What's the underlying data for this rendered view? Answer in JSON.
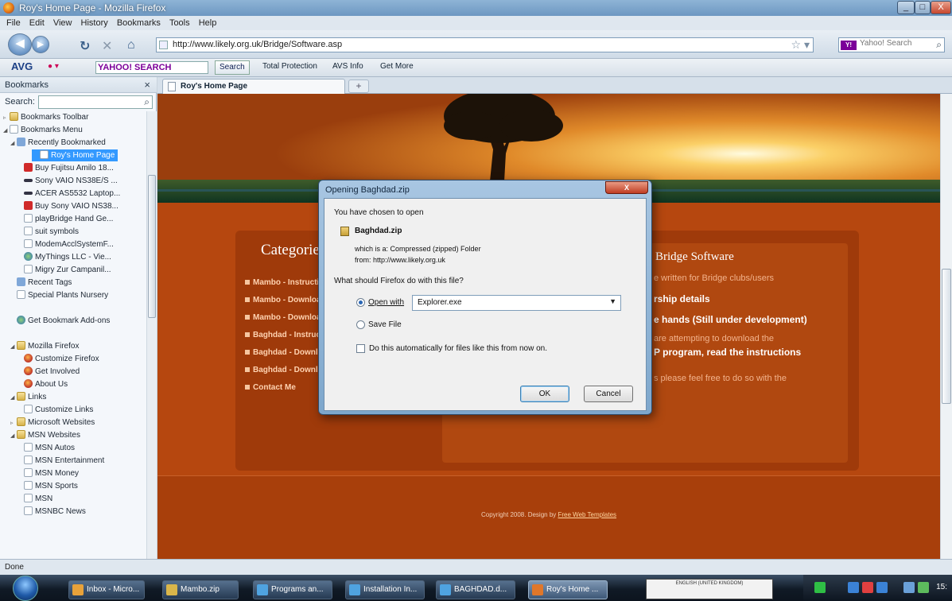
{
  "window": {
    "title": "Roy's Home Page - Mozilla Firefox",
    "controls": [
      "_",
      "□",
      "X"
    ]
  },
  "menu": [
    "File",
    "Edit",
    "View",
    "History",
    "Bookmarks",
    "Tools",
    "Help"
  ],
  "nav": {
    "url": "http://www.likely.org.uk/Bridge/Software.asp",
    "search_placeholder": "Yahoo! Search",
    "search_engine_label": "Y!"
  },
  "avg_toolbar": {
    "logo": "AVG",
    "search_brand": "YAHOO! SEARCH",
    "search_button": "Search",
    "total_protection": "Total Protection",
    "avs_info": "AVS Info",
    "get_more": "Get More"
  },
  "sidebar": {
    "title": "Bookmarks",
    "search_label": "Search:",
    "items": [
      {
        "label": "Bookmarks Toolbar",
        "icon": "folder",
        "indent": 0,
        "tw": "▹"
      },
      {
        "label": "Bookmarks Menu",
        "icon": "page",
        "indent": 0,
        "tw": "◢"
      },
      {
        "label": "Recently Bookmarked",
        "icon": "bookmarkstar",
        "indent": 1,
        "tw": "◢"
      },
      {
        "label": "Roy's Home Page",
        "icon": "page",
        "indent": 2,
        "tw": "",
        "selected": true
      },
      {
        "label": "Buy Fujitsu Amilo 18...",
        "icon": "red",
        "indent": 2,
        "tw": ""
      },
      {
        "label": "Sony VAIO NS38E/S ...",
        "icon": "bar",
        "indent": 2,
        "tw": ""
      },
      {
        "label": "ACER AS5532 Laptop...",
        "icon": "bar",
        "indent": 2,
        "tw": ""
      },
      {
        "label": "Buy Sony VAIO NS38...",
        "icon": "red",
        "indent": 2,
        "tw": ""
      },
      {
        "label": "playBridge Hand Ge...",
        "icon": "page",
        "indent": 2,
        "tw": ""
      },
      {
        "label": "suit symbols",
        "icon": "page",
        "indent": 2,
        "tw": ""
      },
      {
        "label": "ModemAcclSystemF...",
        "icon": "page",
        "indent": 2,
        "tw": ""
      },
      {
        "label": "MyThings LLC - Vie...",
        "icon": "globe",
        "indent": 2,
        "tw": ""
      },
      {
        "label": "Migry Zur Campanil...",
        "icon": "page",
        "indent": 2,
        "tw": ""
      },
      {
        "label": "Recent Tags",
        "icon": "bookmarkstar",
        "indent": 1,
        "tw": ""
      },
      {
        "label": "Special Plants Nursery",
        "icon": "page",
        "indent": 1,
        "tw": ""
      },
      {
        "label": "",
        "icon": "",
        "indent": 0,
        "tw": ""
      },
      {
        "label": "Get Bookmark Add-ons",
        "icon": "globe",
        "indent": 1,
        "tw": ""
      },
      {
        "label": "",
        "icon": "",
        "indent": 0,
        "tw": ""
      },
      {
        "label": "Mozilla Firefox",
        "icon": "folder",
        "indent": 1,
        "tw": "◢"
      },
      {
        "label": "Customize Firefox",
        "icon": "ff",
        "indent": 2,
        "tw": ""
      },
      {
        "label": "Get Involved",
        "icon": "ff",
        "indent": 2,
        "tw": ""
      },
      {
        "label": "About Us",
        "icon": "ff",
        "indent": 2,
        "tw": ""
      },
      {
        "label": "Links",
        "icon": "folder",
        "indent": 1,
        "tw": "◢"
      },
      {
        "label": "Customize Links",
        "icon": "page",
        "indent": 2,
        "tw": ""
      },
      {
        "label": "Microsoft Websites",
        "icon": "folder",
        "indent": 1,
        "tw": "▹"
      },
      {
        "label": "MSN Websites",
        "icon": "folder",
        "indent": 1,
        "tw": "◢"
      },
      {
        "label": "MSN Autos",
        "icon": "page",
        "indent": 2,
        "tw": ""
      },
      {
        "label": "MSN Entertainment",
        "icon": "page",
        "indent": 2,
        "tw": ""
      },
      {
        "label": "MSN Money",
        "icon": "page",
        "indent": 2,
        "tw": ""
      },
      {
        "label": "MSN Sports",
        "icon": "page",
        "indent": 2,
        "tw": ""
      },
      {
        "label": "MSN",
        "icon": "page",
        "indent": 2,
        "tw": ""
      },
      {
        "label": "MSNBC News",
        "icon": "page",
        "indent": 2,
        "tw": ""
      }
    ]
  },
  "tabs": {
    "active_label": "Roy's Home Page",
    "new_tab": "+"
  },
  "page": {
    "categories_heading": "Categories",
    "categories": [
      "Mambo - Instructions",
      "Mambo - Download",
      "Mambo - Download",
      "Baghdad - Instructions",
      "Baghdad - Download",
      "Baghdad - Download",
      "Contact Me"
    ],
    "right_title": "Bridge Software",
    "right_lines": [
      {
        "text": "e written for Bridge clubs/users",
        "bold": false
      },
      {
        "text": "rship details",
        "bold": true
      },
      {
        "text": "e hands (Still under development)",
        "bold": true
      },
      {
        "text": "are attempting to download the",
        "bold": false
      },
      {
        "text": "P program, read the instructions",
        "bold": true
      },
      {
        "text": "s please feel free to do so with the",
        "bold": false
      }
    ],
    "copyright": "Copyright 2008. Design by",
    "copyright_link": "Free Web Templates"
  },
  "dialog": {
    "title": "Opening Baghdad.zip",
    "close": "X",
    "intro": "You have chosen to open",
    "filename": "Baghdad.zip",
    "which_is": "which is a:  Compressed (zipped) Folder",
    "from": "from:  http://www.likely.org.uk",
    "question": "What should Firefox do with this file?",
    "open_with_label": "Open with",
    "open_with_value": "Explorer.exe",
    "save_file_label": "Save File",
    "auto_label": "Do this automatically for files like this from now on.",
    "ok": "OK",
    "cancel": "Cancel"
  },
  "status": {
    "text": "Done"
  },
  "taskbar": {
    "tasks": [
      "Inbox - Micro...",
      "Mambo.zip",
      "Programs an...",
      "Installation In...",
      "BAGHDAD.d...",
      "Roy's Home ..."
    ],
    "task_colors": [
      "#e8a23a",
      "#dab64a",
      "#4fa3e0",
      "#4fa3e0",
      "#4fa3e0",
      "#e0772a"
    ],
    "lang_box": "ENGLISH (UNITED KINGDOM)",
    "clock": "15:"
  }
}
